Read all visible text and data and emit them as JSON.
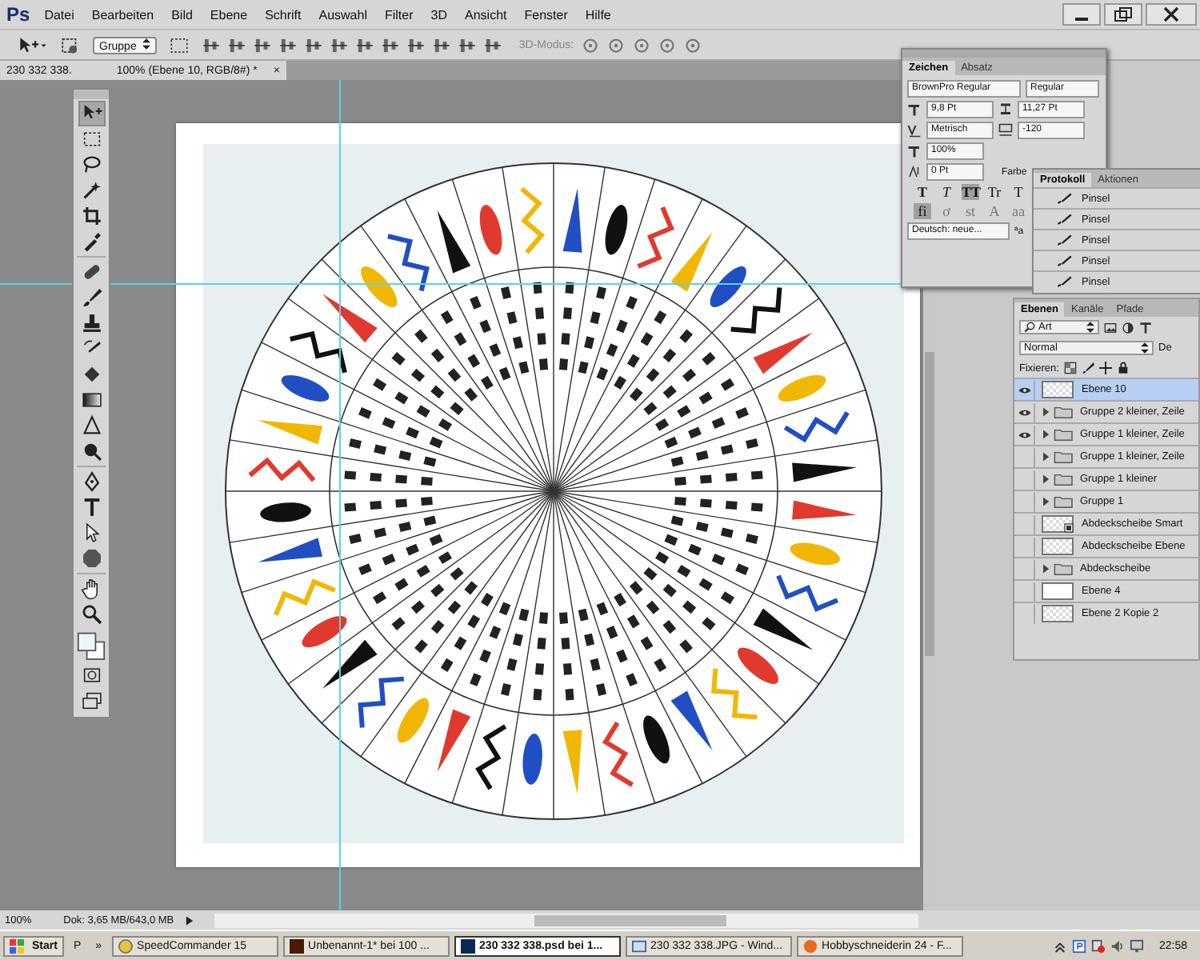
{
  "app": {
    "logo": "Ps"
  },
  "menu": [
    "Datei",
    "Bearbeiten",
    "Bild",
    "Ebene",
    "Schrift",
    "Auswahl",
    "Filter",
    "3D",
    "Ansicht",
    "Fenster",
    "Hilfe"
  ],
  "options_bar": {
    "auto_select": "Gruppe",
    "mode_label": "3D-Modus:"
  },
  "doc_tab": {
    "title_start": "230 332 338.",
    "title_end": "100% (Ebene 10, RGB/8#) *",
    "close": "×"
  },
  "tools": [
    {
      "kind": "move",
      "selected": true
    },
    {
      "kind": "marquee",
      "selected": false
    },
    {
      "kind": "lasso",
      "selected": false
    },
    {
      "kind": "wand",
      "selected": false
    },
    {
      "kind": "crop",
      "selected": false
    },
    {
      "kind": "eyedropper",
      "selected": false
    },
    {
      "kind": "healing",
      "selected": false
    },
    {
      "kind": "brush",
      "selected": false
    },
    {
      "kind": "stamp",
      "selected": false
    },
    {
      "kind": "historybrush",
      "selected": false
    },
    {
      "kind": "eraser",
      "selected": false
    },
    {
      "kind": "gradient",
      "selected": false
    },
    {
      "kind": "blur",
      "selected": false
    },
    {
      "kind": "dodge",
      "selected": false
    },
    {
      "kind": "pen",
      "selected": false
    },
    {
      "kind": "type",
      "selected": false
    },
    {
      "kind": "pathselect",
      "selected": false
    },
    {
      "kind": "shape",
      "selected": false
    },
    {
      "kind": "hand",
      "selected": false
    },
    {
      "kind": "zoom",
      "selected": false
    }
  ],
  "character_panel": {
    "tabs": [
      {
        "label": "Zeichen",
        "selected": true
      },
      {
        "label": "Absatz",
        "selected": false
      }
    ],
    "font_family": "BrownPro Regular",
    "font_style": "Regular",
    "size": "9,8 Pt",
    "leading": "11,27 Pt",
    "kerning": "Metrisch",
    "tracking": "-120",
    "vertical_scale": "100%",
    "baseline_shift": "0 Pt",
    "color_label": "Farbe",
    "type_styles": [
      {
        "label": "T",
        "kind": "bold",
        "selected": false
      },
      {
        "label": "T",
        "kind": "italic",
        "selected": false
      },
      {
        "label": "TT",
        "kind": "caps",
        "selected": true
      },
      {
        "label": "Tr",
        "kind": "smallcaps",
        "selected": false
      },
      {
        "label": "T",
        "kind": "super",
        "selected": false
      }
    ],
    "opentype_styles": [
      {
        "label": "fi",
        "selected": true
      },
      {
        "label": "ơ",
        "selected": false
      },
      {
        "label": "st",
        "selected": false
      },
      {
        "label": "A",
        "selected": false
      },
      {
        "label": "aa",
        "selected": false
      }
    ],
    "language": "Deutsch: neue...",
    "antialias": "ªa"
  },
  "history_panel": {
    "tabs": [
      {
        "label": "Protokoll",
        "selected": true
      },
      {
        "label": "Aktionen",
        "selected": false
      }
    ],
    "items": [
      "Pinsel",
      "Pinsel",
      "Pinsel",
      "Pinsel",
      "Pinsel"
    ]
  },
  "layers_panel": {
    "tabs": [
      {
        "label": "Ebenen",
        "selected": true
      },
      {
        "label": "Kanäle",
        "selected": false
      },
      {
        "label": "Pfade",
        "selected": false
      }
    ],
    "filter": "Art",
    "blend_mode": "Normal",
    "opacity_label": "De",
    "lock_label": "Fixieren:",
    "layers": [
      {
        "name": "Ebene 10",
        "kind": "pixel",
        "visible": true,
        "selected": true
      },
      {
        "name": "Gruppe 2 kleiner, Zeile",
        "kind": "group",
        "visible": true,
        "selected": false
      },
      {
        "name": "Gruppe 1 kleiner, Zeile",
        "kind": "group",
        "visible": true,
        "selected": false
      },
      {
        "name": "Gruppe 1 kleiner, Zeile",
        "kind": "group",
        "visible": false,
        "selected": false
      },
      {
        "name": "Gruppe 1 kleiner",
        "kind": "group",
        "visible": false,
        "selected": false
      },
      {
        "name": "Gruppe 1",
        "kind": "group",
        "visible": false,
        "selected": false
      },
      {
        "name": "Abdeckscheibe Smart",
        "kind": "smart",
        "visible": false,
        "selected": false
      },
      {
        "name": "Abdeckscheibe Ebene",
        "kind": "pixel",
        "visible": false,
        "selected": false
      },
      {
        "name": "Abdeckscheibe",
        "kind": "group",
        "visible": false,
        "selected": false
      },
      {
        "name": "Ebene 4",
        "kind": "white",
        "visible": false,
        "selected": false
      },
      {
        "name": "Ebene 2 Kopie 2",
        "kind": "pixel",
        "visible": false,
        "selected": false
      }
    ]
  },
  "status_bar": {
    "zoom": "100%",
    "doc_info": "Dok: 3,65 MB/643,0 MB"
  },
  "taskbar": {
    "start": "Start",
    "quick_launch": "P",
    "more": "»",
    "items": [
      {
        "label": "SpeedCommander 15",
        "kind": "commander",
        "selected": false
      },
      {
        "label": "Unbenannt-1* bei 100 ...",
        "kind": "illustrator",
        "selected": false
      },
      {
        "label": "230 332 338.psd bei 1...",
        "kind": "photoshop",
        "selected": true
      },
      {
        "label": "230 332 338.JPG - Wind...",
        "kind": "viewer",
        "selected": false
      },
      {
        "label": "Hobbyschneiderin 24 - F...",
        "kind": "browser",
        "selected": false
      }
    ],
    "clock": "22:58"
  }
}
